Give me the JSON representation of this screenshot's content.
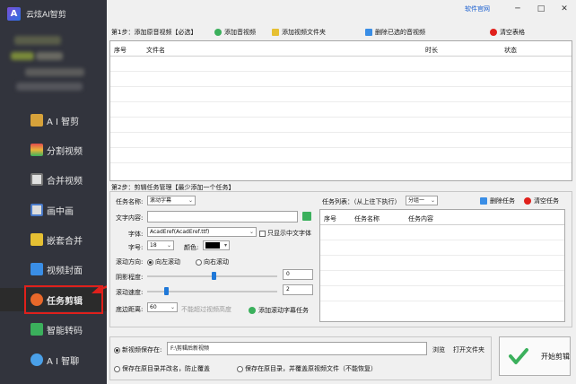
{
  "app": {
    "logo_text": "A",
    "title": "云炫AI智剪"
  },
  "sidebar": {
    "items": [
      {
        "label": "A I 智剪",
        "icon": "ai-clip-icon",
        "color": "#d7a23a",
        "active": false
      },
      {
        "label": "分割视频",
        "icon": "split-video-icon",
        "color": "#e24c4c",
        "active": false
      },
      {
        "label": "合并视频",
        "icon": "merge-video-icon",
        "color": "#e0e0e0",
        "active": false
      },
      {
        "label": "画中画",
        "icon": "pip-icon",
        "color": "#e0e0e0",
        "active": false
      },
      {
        "label": "嵌套合并",
        "icon": "nest-merge-icon",
        "color": "#e6c033",
        "active": false
      },
      {
        "label": "视频封面",
        "icon": "video-cover-icon",
        "color": "#3a8ee6",
        "active": false
      },
      {
        "label": "任务剪辑",
        "icon": "task-clip-icon",
        "color": "#e8682a",
        "active": true
      },
      {
        "label": "智能转码",
        "icon": "transcode-icon",
        "color": "#3bb05c",
        "active": false
      },
      {
        "label": "A I 智聊",
        "icon": "ai-chat-icon",
        "color": "#4aa0e8",
        "active": false
      }
    ]
  },
  "topbar": {
    "website_link": "软件官网",
    "minimize": "─",
    "maximize": "□",
    "close": "✕"
  },
  "step1": {
    "label": "第1步：添加原音视频【必选】",
    "add_video": "添加音视频",
    "add_folder": "添加视频文件夹",
    "delete_selected": "删除已选的音视频",
    "clear_table": "清空表格",
    "columns": {
      "index": "序号",
      "filename": "文件名",
      "duration": "时长",
      "status": "状态"
    }
  },
  "step2": {
    "label": "第2步：剪辑任务管理【最少添加一个任务】",
    "task_name_label": "任务名称:",
    "task_name_value": "滚动字幕",
    "text_content_label": "文字内容:",
    "text_content_value": "",
    "font_label": "字体:",
    "font_value": "AcadEref(AcadEref.ttf)",
    "chinese_only_label": "只显示中文字体",
    "size_label": "字号:",
    "size_value": "18",
    "color_label": "颜色:",
    "scroll_dir_label": "滚动方向:",
    "scroll_left": "向左滚动",
    "scroll_right": "向右滚动",
    "shadow_label": "阴影程度:",
    "shadow_value": "0",
    "speed_label": "滚动速度:",
    "speed_value": "2",
    "bottom_label": "底边距离:",
    "bottom_value": "60",
    "bottom_hint": "不能超过视频高度",
    "add_task_button": "添加滚动字幕任务",
    "task_list_label": "任务列表：（从上往下执行）",
    "group_value": "分组一",
    "delete_task": "删除任务",
    "clear_tasks": "清空任务",
    "task_columns": {
      "index": "序号",
      "name": "任务名称",
      "content": "任务内容"
    }
  },
  "save": {
    "new_video_label": "新视频保存在:",
    "path_value": "F:\\剪辑后新视频",
    "browse": "浏览",
    "open_folder": "打开文件夹",
    "option_rename": "保存在原目录并改名，防止覆盖",
    "option_overwrite": "保存在原目录，并覆盖原视频文件（不能恢复）",
    "start_button": "开始剪辑"
  },
  "colors": {
    "sidebar_bg": "#32343d",
    "highlight_red": "#e0201b",
    "link_blue": "#1a5fd0",
    "slider_blue": "#1f78d8"
  }
}
